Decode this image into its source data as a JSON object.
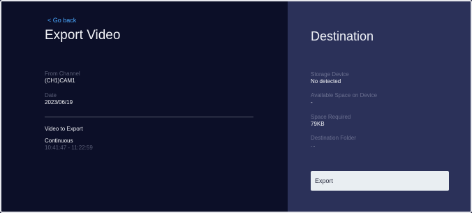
{
  "left_panel": {
    "back_label": "< Go back",
    "title": "Export Video",
    "from_channel_label": "From Channel",
    "from_channel_value": "(CH1)CAM1",
    "date_label": "Date",
    "date_value": "2023/06/19",
    "section_label": "Video to Export",
    "mode_value": "Continuous",
    "time_range": "10:41:47 - 11:22:59"
  },
  "right_panel": {
    "title": "Destination",
    "storage_label": "Storage Device",
    "storage_value": "No detected",
    "available_label": "Available Space on Device",
    "available_value": "-",
    "required_label": "Space Required",
    "required_value": "79KB",
    "folder_label": "Destination Folder",
    "folder_value": "...",
    "export_label": "Export"
  },
  "colors": {
    "left_bg": "#0c0f28",
    "right_bg": "#2b3159",
    "accent_link": "#4aa8ff",
    "button_bg": "#e9eef2"
  }
}
